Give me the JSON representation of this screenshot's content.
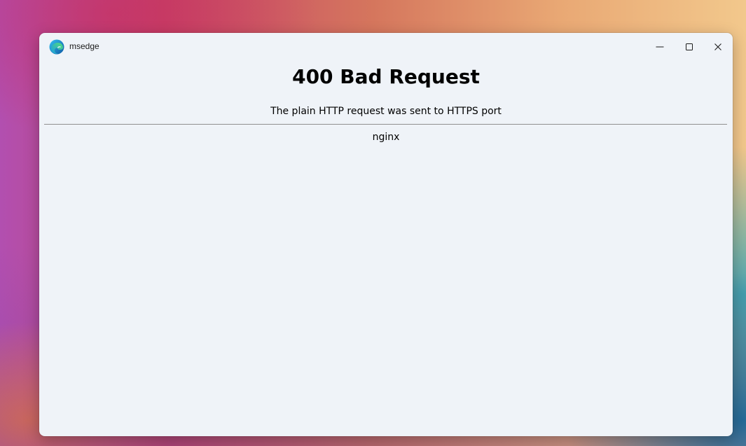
{
  "window": {
    "app_title": "msedge",
    "app_icon": "edge-logo-icon",
    "controls": {
      "minimize_icon": "minimize-icon",
      "maximize_icon": "maximize-icon",
      "close_icon": "close-icon"
    }
  },
  "page": {
    "heading": "400 Bad Request",
    "message": "The plain HTTP request was sent to HTTPS port",
    "server": "nginx"
  },
  "colors": {
    "window_background": "#eff3f8",
    "text": "#000000",
    "rule": "#8f8f8f"
  }
}
